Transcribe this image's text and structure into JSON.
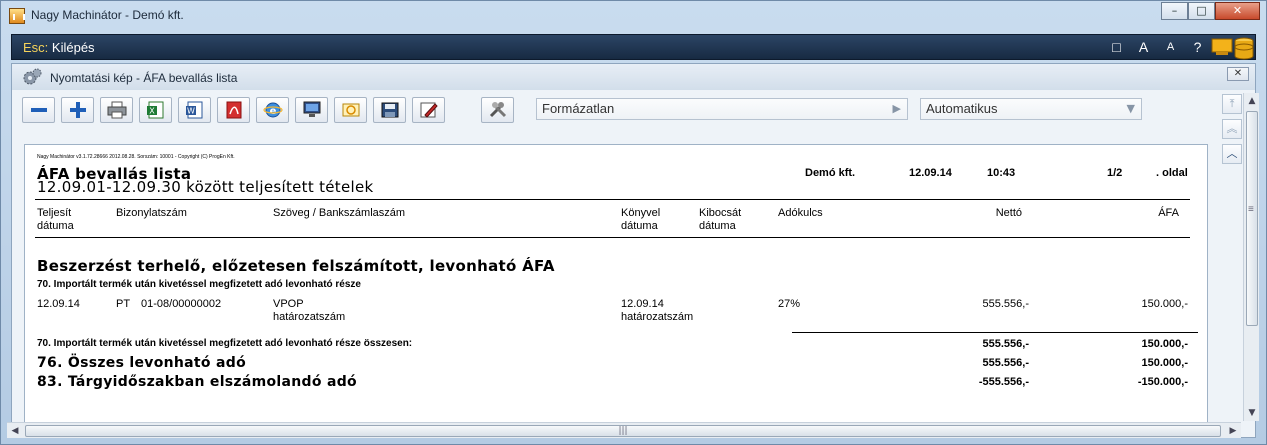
{
  "window": {
    "title": "Nagy Machinátor - Demó kft.",
    "buttons": {
      "minimize": "–",
      "maximize": "□",
      "close": "✕"
    }
  },
  "menubar": {
    "esc_key": "Esc:",
    "esc_label": "Kilépés",
    "tools": {
      "window": "□",
      "font_large": "A",
      "font_small": "A",
      "help": "?"
    }
  },
  "inner": {
    "title": "Nyomtatási kép - ÁFA bevallás lista",
    "close": "✕"
  },
  "toolbar": {
    "format_value": "Formázatlan",
    "mode_value": "Automatikus"
  },
  "report": {
    "header_line": "Nagy Machinátor v3.1.72.28666 2012.08.28. Sorszám: 10001 - Copyright (C) ProgEn Kft.",
    "title": "ÁFA bevallás lista",
    "subtitle": "12.09.01-12.09.30 között teljesített tételek",
    "company": "Demó kft.",
    "date": "12.09.14",
    "time": "10:43",
    "page": "1/2",
    "page_label": ". oldal",
    "columns": {
      "teljesit": "Teljesít",
      "teljesit2": "dátuma",
      "bizonylat": "Bizonylatszám",
      "szoveg": "Szöveg / Bankszámlaszám",
      "konyvel": "Könyvel",
      "konyvel2": "dátuma",
      "kibocsat": "Kibocsát",
      "kibocsat2": "dátuma",
      "adokulcs": "Adókulcs",
      "netto": "Nettó",
      "afa": "ÁFA"
    },
    "section_title": "Beszerzést terhelő, előzetesen felszámított, levonható ÁFA",
    "group_title": "70. Importált termék után kivetéssel megfizetett adó levonható része",
    "row": {
      "date": "12.09.14",
      "type": "PT",
      "doc": "01-08/00000002",
      "text1": "VPOP",
      "text2": "határozatszám",
      "book_date": "12.09.14",
      "book_sub": "határozatszám",
      "rate": "27%",
      "net": "555.556,-",
      "vat": "150.000,-"
    },
    "group_total_label": "70. Importált termék után kivetéssel megfizetett adó levonható része összesen:",
    "group_total_net": "555.556,-",
    "group_total_vat": "150.000,-",
    "total76_label": "76. Összes levonható adó",
    "total76_net": "555.556,-",
    "total76_vat": "150.000,-",
    "total83_label": "83. Tárgyidőszakban elszámolandó adó",
    "total83_net": "-555.556,-",
    "total83_vat": "-150.000,-"
  }
}
